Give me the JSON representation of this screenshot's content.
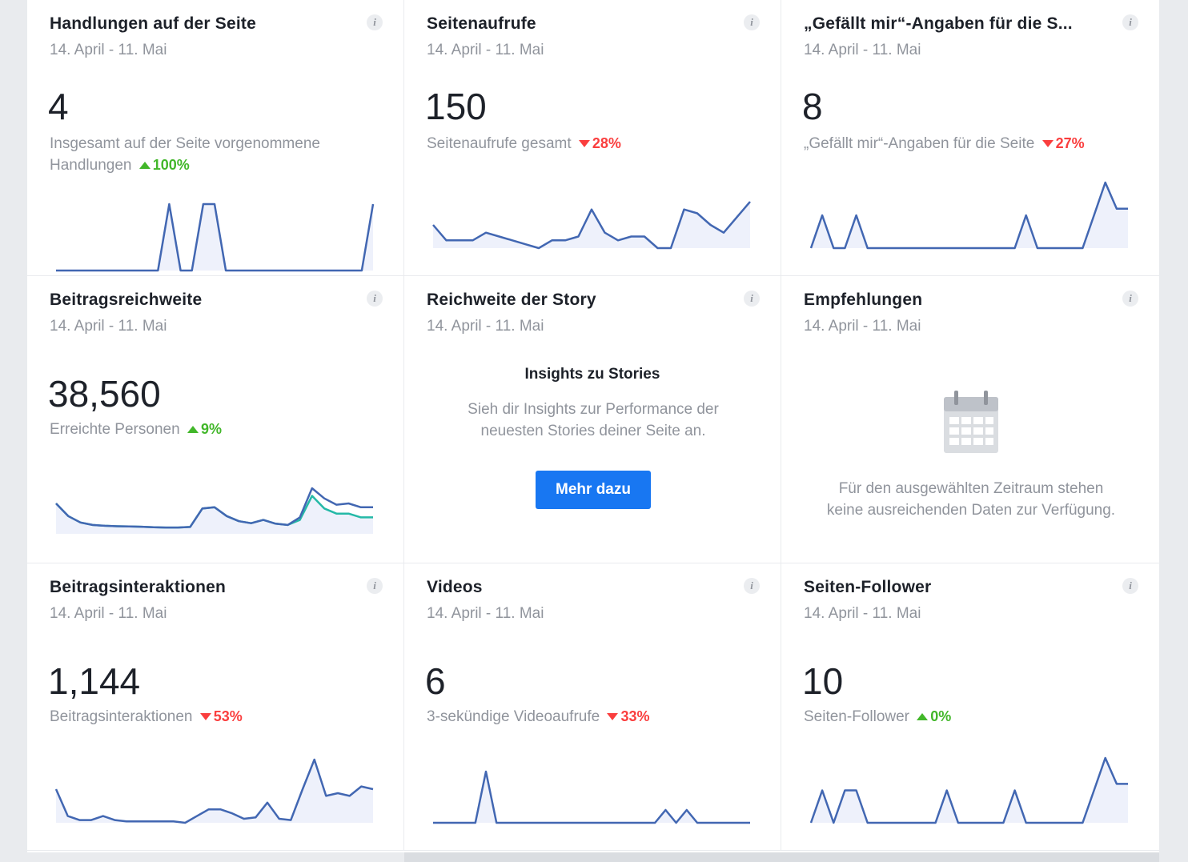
{
  "cards": [
    {
      "title": "Handlungen auf der Seite",
      "date": "14. April - 11. Mai",
      "value": "4",
      "desc": "Insgesamt auf der Seite vorgenommene Handlungen",
      "change": "100%",
      "dir": "up",
      "series": [
        [
          0,
          0,
          0,
          0,
          0,
          0,
          0,
          0,
          0,
          0,
          1,
          0,
          0,
          1,
          1,
          0,
          0,
          0,
          0,
          0,
          0,
          0,
          0,
          0,
          0,
          0,
          0,
          0,
          1
        ]
      ]
    },
    {
      "title": "Seitenaufrufe",
      "date": "14. April - 11. Mai",
      "value": "150",
      "desc": "Seitenaufrufe gesamt",
      "change": "28%",
      "dir": "down",
      "series": [
        [
          6,
          2,
          2,
          2,
          4,
          3,
          2,
          1,
          0,
          2,
          2,
          3,
          10,
          4,
          2,
          3,
          3,
          0,
          0,
          10,
          9,
          6,
          4,
          8,
          12
        ]
      ]
    },
    {
      "title": "„Gefällt mir“-Angaben für die S...",
      "date": "14. April - 11. Mai",
      "value": "8",
      "desc": "„Gefällt mir“-Angaben für die Seite",
      "change": "27%",
      "dir": "down",
      "series": [
        [
          0,
          1,
          0,
          0,
          1,
          0,
          0,
          0,
          0,
          0,
          0,
          0,
          0,
          0,
          0,
          0,
          0,
          0,
          0,
          1,
          0,
          0,
          0,
          0,
          0,
          1,
          2,
          1.2,
          1.2
        ]
      ]
    },
    {
      "title": "Beitragsreichweite",
      "date": "14. April - 11. Mai",
      "value": "38,560",
      "desc": "Erreichte Personen",
      "change": "9%",
      "dir": "up",
      "series": [
        [
          1200,
          700,
          450,
          350,
          320,
          300,
          290,
          280,
          260,
          250,
          250,
          270,
          1000,
          1050,
          700,
          500,
          420,
          550,
          400,
          350,
          650,
          1800,
          1400,
          1150,
          1200,
          1050,
          1050
        ],
        [
          1200,
          700,
          450,
          350,
          320,
          300,
          290,
          280,
          260,
          250,
          250,
          270,
          1000,
          1050,
          700,
          500,
          420,
          550,
          400,
          350,
          550,
          1500,
          1000,
          800,
          800,
          650,
          650
        ]
      ]
    },
    {
      "title": "Reichweite der Story",
      "date": "14. April - 11. Mai",
      "story_heading": "Insights zu Stories",
      "story_text": "Sieh dir Insights zur Performance der neuesten Stories deiner Seite an.",
      "button": "Mehr dazu"
    },
    {
      "title": "Empfehlungen",
      "date": "14. April - 11. Mai",
      "empty_text": "Für den ausgewählten Zeitraum stehen keine ausreichenden Daten zur Verfügung.",
      "icon": "calendar-icon"
    },
    {
      "title": "Beitragsinteraktionen",
      "date": "14. April - 11. Mai",
      "value": "1,144",
      "desc": "Beitragsinteraktionen",
      "change": "53%",
      "dir": "down",
      "series": [
        [
          25,
          5,
          2,
          2,
          5,
          2,
          1,
          1,
          1,
          1,
          1,
          0,
          5,
          10,
          10,
          7,
          3,
          4,
          15,
          3,
          2,
          25,
          47,
          20,
          22,
          20,
          27,
          25
        ]
      ]
    },
    {
      "title": "Videos",
      "date": "14. April - 11. Mai",
      "value": "6",
      "desc": "3-sekündige Videoaufrufe",
      "change": "33%",
      "dir": "down",
      "series": [
        [
          0,
          0,
          0,
          0,
          0,
          1,
          0,
          0,
          0,
          0,
          0,
          0,
          0,
          0,
          0,
          0,
          0,
          0,
          0,
          0,
          0,
          0,
          0.25,
          0,
          0.25,
          0,
          0,
          0,
          0,
          0,
          0
        ]
      ]
    },
    {
      "title": "Seiten-Follower",
      "date": "14. April - 11. Mai",
      "value": "10",
      "desc": "Seiten-Follower",
      "change": "0%",
      "dir": "up",
      "series": [
        [
          0,
          1,
          0,
          1,
          1,
          0,
          0,
          0,
          0,
          0,
          0,
          0,
          1,
          0,
          0,
          0,
          0,
          0,
          1,
          0,
          0,
          0,
          0,
          0,
          0,
          1,
          2,
          1.2,
          1.2
        ]
      ]
    }
  ],
  "colors": {
    "line": "#4267b2",
    "area": "#eef1fb",
    "teal": "#25b9a7",
    "accent": "#1877f2",
    "down": "#fa3e3e",
    "up": "#42b72a"
  }
}
